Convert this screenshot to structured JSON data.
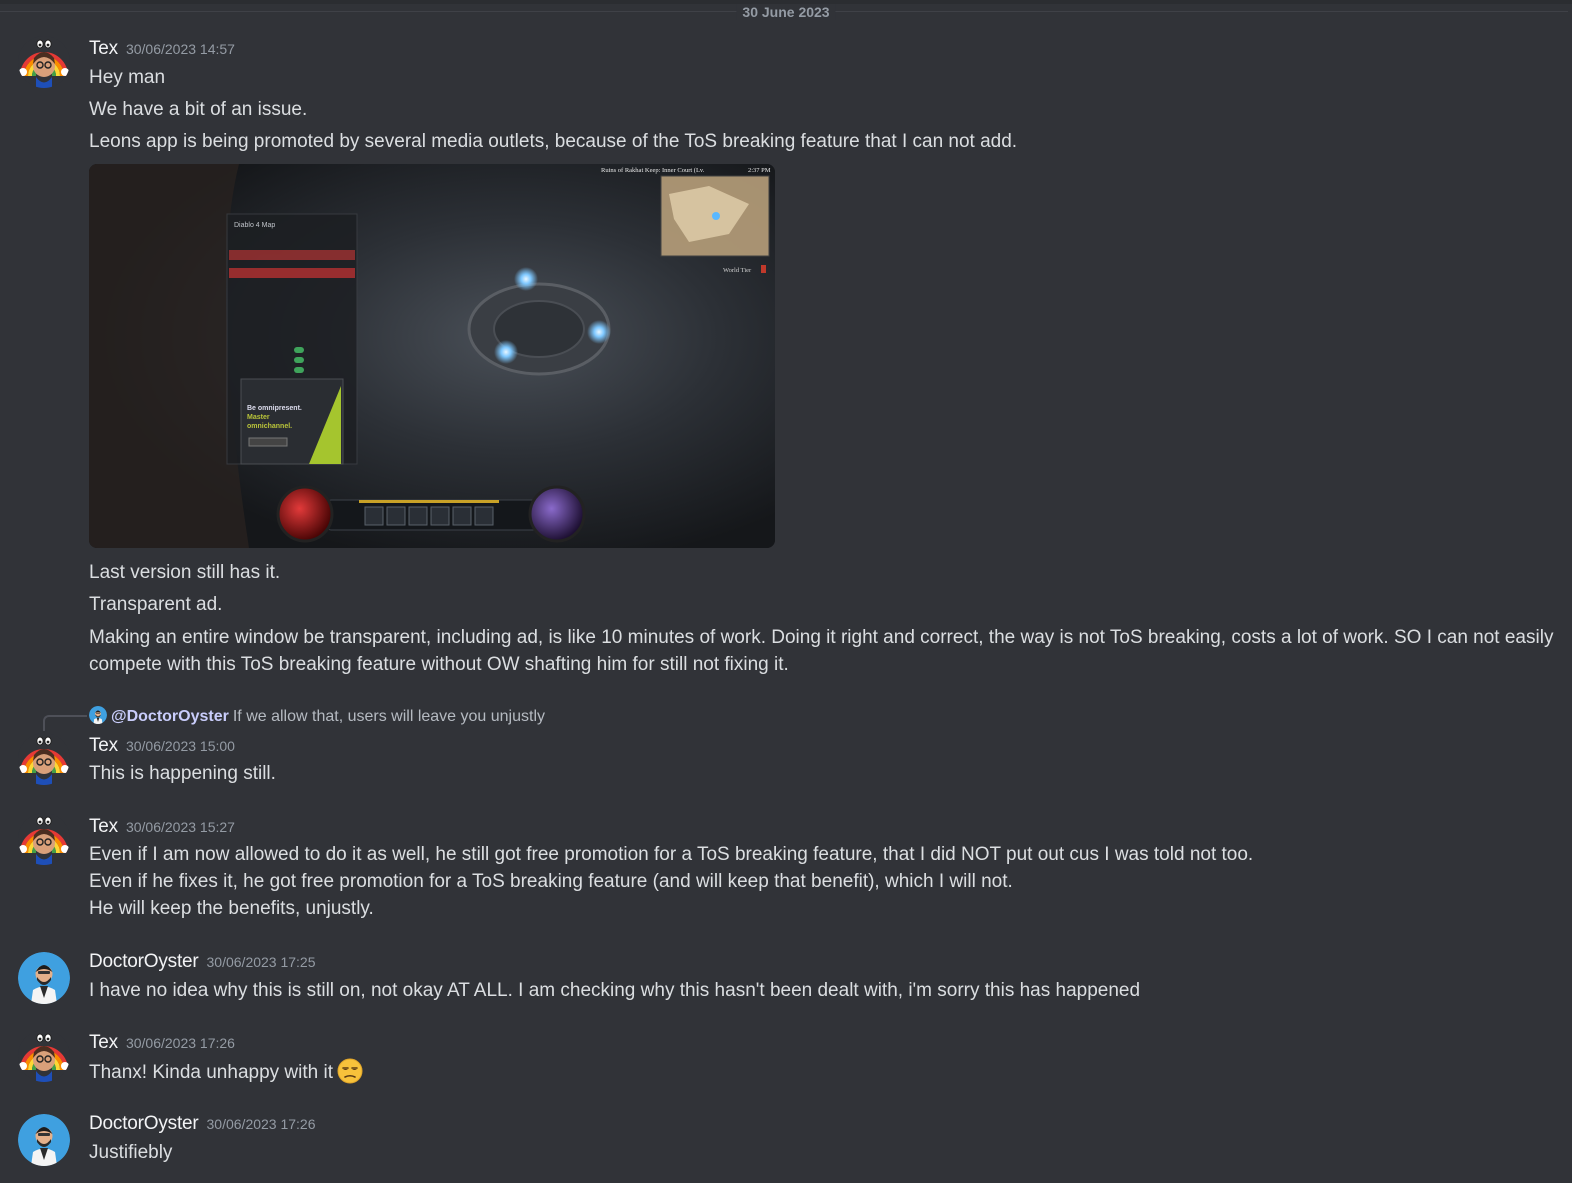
{
  "date_divider": "30 June 2023",
  "users": {
    "tex": "Tex",
    "doctor": "DoctorOyster"
  },
  "messages": [
    {
      "username": "Tex",
      "timestamp": "30/06/2023 14:57",
      "lines": [
        "Hey man",
        "We have a bit of an issue.",
        "Leons app is being promoted by several media outlets, because of the ToS breaking feature that I can not add."
      ],
      "attachment": {
        "hud_location": "Ruins of Rakhat Keep: Inner Court (Lv.",
        "hud_time": "2:37 PM",
        "hud_world_tier": "World Tier",
        "overlay_title": "Diablo 4 Map",
        "ad_line1": "Be omnipresent.",
        "ad_line2": "Master",
        "ad_line3": "omnichannel."
      },
      "after_lines": [
        "Last version still has it.",
        "Transparent ad.",
        "Making an entire window be transparent, including ad, is like 10 minutes of work. Doing it right and correct, the way is not ToS breaking, costs a lot of work. SO I can not easily compete with this ToS breaking feature without OW shafting him for still not fixing it."
      ]
    },
    {
      "reply": {
        "mention": "@DoctorOyster",
        "text": "If we allow that, users will leave you unjustly"
      },
      "username": "Tex",
      "timestamp": "30/06/2023 15:00",
      "lines": [
        "This is happening still."
      ]
    },
    {
      "username": "Tex",
      "timestamp": "30/06/2023 15:27",
      "lines": [
        "Even if I am now allowed to do it as well, he still got free promotion for a ToS breaking feature, that I did NOT put out cus I was told not too.",
        "Even if he fixes it, he got free promotion for a ToS breaking feature (and will keep that benefit), which I will not.",
        "He will keep the benefits, unjustly."
      ]
    },
    {
      "username": "DoctorOyster",
      "timestamp": "30/06/2023 17:25",
      "lines": [
        "I have no idea why this is still on, not okay AT ALL. I am checking why this hasn't been dealt with, i'm sorry this has happened"
      ]
    },
    {
      "username": "Tex",
      "timestamp": "30/06/2023 17:26",
      "lines": [
        "Thanx! Kinda unhappy with it"
      ],
      "emoji": "unamused-face"
    },
    {
      "username": "DoctorOyster",
      "timestamp": "30/06/2023 17:26",
      "lines": [
        "Justifiebly"
      ]
    }
  ],
  "colors": {
    "background": "#313338",
    "username": "#f2f3f5",
    "timestamp": "#949ba4",
    "text": "#dbdee1",
    "mention": "#c9cdfb",
    "doctor_avatar": "#3fa0e0"
  },
  "icons": {
    "tex_avatar": "rainbow-cartoon-avatar-icon",
    "doctor_avatar": "doctor-avatar-icon",
    "emoji": "unamused-face-emoji-icon"
  }
}
